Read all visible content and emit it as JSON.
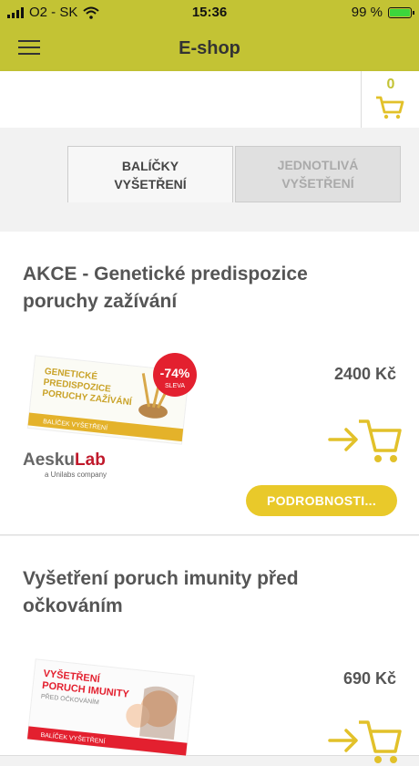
{
  "status": {
    "carrier": "O2 - SK",
    "time": "15:36",
    "battery": "99 %",
    "battery_level": 0.99
  },
  "appbar": {
    "title": "E-shop",
    "menu_icon": "hamburger-icon"
  },
  "search": {
    "value": "",
    "placeholder": ""
  },
  "cart": {
    "count": "0",
    "icon": "cart-icon"
  },
  "tabs": [
    {
      "label_line1": "BALÍČKY",
      "label_line2": "VYŠETŘENÍ",
      "active": true
    },
    {
      "label_line1": "JEDNOTLIVÁ",
      "label_line2": "VYŠETŘENÍ",
      "active": false
    }
  ],
  "products": [
    {
      "title": "AKCE - Genetické predispozice poruchy zažívání",
      "price": "2400 Kč",
      "details_label": "PODROBNOSTI...",
      "image": {
        "line1": "GENETICKÉ",
        "line2": "PREDISPOZICE",
        "line3": "PORUCHY ZAŽÍVÁNÍ",
        "footer": "BALÍČEK VYŠETŘENÍ",
        "badge_value": "-74%",
        "badge_label": "SLEVA"
      },
      "brand": {
        "name_a": "Aesku",
        "name_b": "Lab",
        "tagline": "a Unilabs company"
      }
    },
    {
      "title": "Vyšetření poruch imunity před očkováním",
      "price": "690 Kč",
      "image": {
        "line1": "VYŠETŘENÍ",
        "line2": "PORUCH IMUNITY",
        "line3": "PŘED OČKOVÁNÍM",
        "footer": "BALÍČEK VYŠETŘENÍ"
      }
    }
  ],
  "colors": {
    "brand": "#c3c334",
    "accent": "#e9c92a",
    "badge": "#e3202f"
  }
}
